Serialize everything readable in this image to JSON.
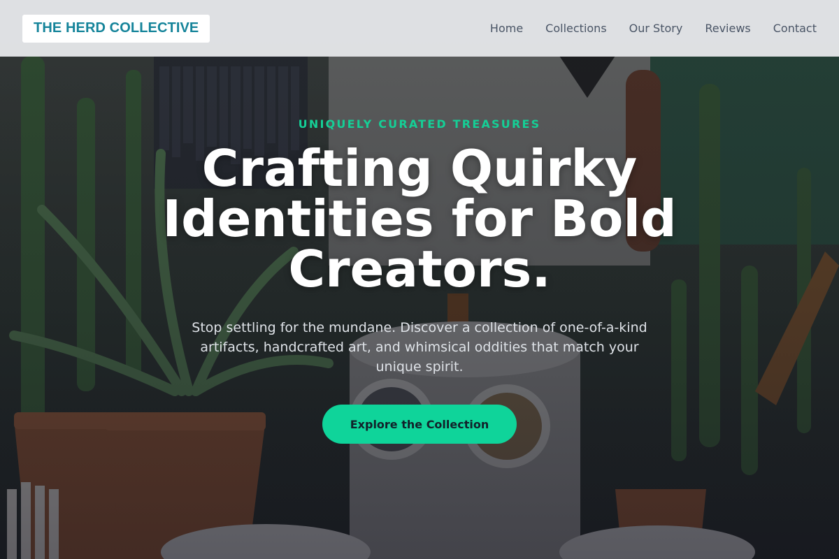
{
  "header": {
    "logo_text": "THE HERD COLLECTIVE",
    "nav": [
      "Home",
      "Collections",
      "Our Story",
      "Reviews",
      "Contact"
    ]
  },
  "hero": {
    "eyebrow": "UNIQUELY CURATED TREASURES",
    "headline": "Crafting Quirky Identities for Bold Creators.",
    "subtext": "Stop settling for the mundane. Discover a collection of one-of-a-kind artifacts, handcrafted art, and whimsical oddities that match your unique spirit.",
    "cta_label": "Explore the Collection",
    "background_image": "shop-interior-with-cacti-and-pottery"
  },
  "colors": {
    "accent": "#0fd49a",
    "eyebrow": "#15cf96",
    "logo": "#15849a",
    "nav_text": "#4a5566",
    "header_bg": "#ecedf0",
    "headline": "#ffffff"
  }
}
